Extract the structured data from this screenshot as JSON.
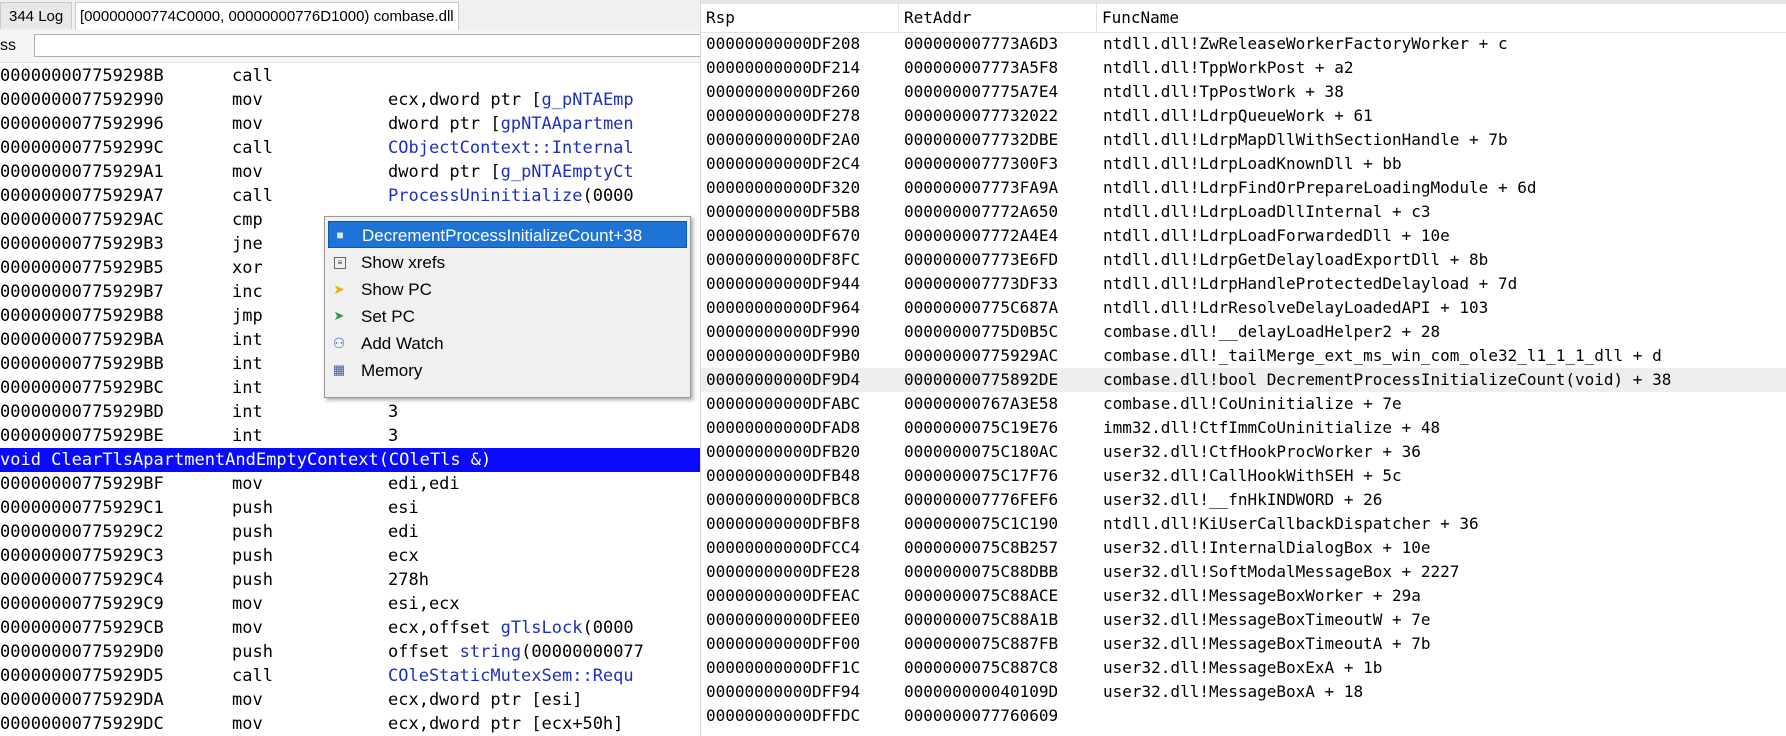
{
  "tabs": {
    "log": "344 Log",
    "module": "[00000000774C0000, 00000000776D1000) combase.dll"
  },
  "address_bar": {
    "label": "ss",
    "value": ""
  },
  "disasm": [
    {
      "addr": "000000007759298B",
      "mn": "call",
      "op": "",
      "sym": false
    },
    {
      "addr": "0000000077592990",
      "mn": "mov",
      "op": "ecx,dword ptr [",
      "sym_text": "g_pNTAEmp",
      "sym": true
    },
    {
      "addr": "0000000077592996",
      "mn": "mov",
      "op": "dword ptr [",
      "sym_text": "gpNTAApartmen",
      "sym": true
    },
    {
      "addr": "000000007759299C",
      "mn": "call",
      "op": "",
      "sym_text": "CObjectContext::Internal",
      "sym": true
    },
    {
      "addr": "00000000775929A1",
      "mn": "mov",
      "op": "dword ptr [",
      "sym_text": "g_pNTAEmptyCt",
      "sym": true
    },
    {
      "addr": "00000000775929A7",
      "mn": "call",
      "op": "",
      "sym_text": "ProcessUninitialize",
      "op2": "(0000",
      "sym": true
    },
    {
      "addr": "00000000775929AC",
      "mn": "cmp",
      "op": "",
      "sym": false
    },
    {
      "addr": "00000000775929B3",
      "mn": "jne",
      "op": "",
      "sym": false
    },
    {
      "addr": "00000000775929B5",
      "mn": "xor",
      "op": "",
      "sym": false
    },
    {
      "addr": "00000000775929B7",
      "mn": "inc",
      "op": "",
      "sym": false
    },
    {
      "addr": "00000000775929B8",
      "mn": "jmp",
      "op": "",
      "sym": false
    },
    {
      "addr": "00000000775929BA",
      "mn": "int",
      "op": "",
      "sym": false
    },
    {
      "addr": "00000000775929BB",
      "mn": "int",
      "op": "",
      "sym": false
    },
    {
      "addr": "00000000775929BC",
      "mn": "int",
      "op": "",
      "sym": false
    },
    {
      "addr": "00000000775929BD",
      "mn": "int",
      "op": "3",
      "sym": false
    },
    {
      "addr": "00000000775929BE",
      "mn": "int",
      "op": "3",
      "sym": false
    }
  ],
  "func_header": "void ClearTlsApartmentAndEmptyContext(COleTls &)",
  "disasm2": [
    {
      "addr": "00000000775929BF",
      "mn": "mov",
      "op": "edi,edi",
      "sym": false
    },
    {
      "addr": "00000000775929C1",
      "mn": "push",
      "op": "esi",
      "sym": false
    },
    {
      "addr": "00000000775929C2",
      "mn": "push",
      "op": "edi",
      "sym": false
    },
    {
      "addr": "00000000775929C3",
      "mn": "push",
      "op": "ecx",
      "sym": false
    },
    {
      "addr": "00000000775929C4",
      "mn": "push",
      "op": "278h",
      "sym": false
    },
    {
      "addr": "00000000775929C9",
      "mn": "mov",
      "op": "esi,ecx",
      "sym": false
    },
    {
      "addr": "00000000775929CB",
      "mn": "mov",
      "op": "ecx,offset ",
      "sym_text": "gTlsLock",
      "op2": "(0000",
      "sym": true
    },
    {
      "addr": "00000000775929D0",
      "mn": "push",
      "op": "offset ",
      "sym_text": "string",
      "op2": "(00000000077",
      "sym": true
    },
    {
      "addr": "00000000775929D5",
      "mn": "call",
      "op": "",
      "sym_text": "COleStaticMutexSem::Requ",
      "sym": true
    },
    {
      "addr": "00000000775929DA",
      "mn": "mov",
      "op": "ecx,dword ptr [esi]",
      "sym": false
    },
    {
      "addr": "00000000775929DC",
      "mn": "mov",
      "op": "ecx,dword ptr [ecx+50h]",
      "sym": false
    }
  ],
  "context_menu": {
    "items": [
      {
        "label": "DecrementProcessInitializeCount+38",
        "icon": "location-icon"
      },
      {
        "label": "Show xrefs",
        "icon": "xrefs-icon"
      },
      {
        "label": "Show PC",
        "icon": "arrow-right-icon"
      },
      {
        "label": "Set PC",
        "icon": "set-pc-icon"
      },
      {
        "label": "Add Watch",
        "icon": "watch-icon"
      },
      {
        "label": "Memory",
        "icon": "memory-icon"
      }
    ]
  },
  "stack": {
    "headers": {
      "rsp": "Rsp",
      "ret": "RetAddr",
      "fn": "FuncName"
    },
    "rows": [
      {
        "rsp": "00000000000DF208",
        "ret": "000000007773A6D3",
        "fn": "ntdll.dll!ZwReleaseWorkerFactoryWorker + c"
      },
      {
        "rsp": "00000000000DF214",
        "ret": "000000007773A5F8",
        "fn": "ntdll.dll!TppWorkPost + a2"
      },
      {
        "rsp": "00000000000DF260",
        "ret": "000000007775A7E4",
        "fn": "ntdll.dll!TpPostWork + 38"
      },
      {
        "rsp": "00000000000DF278",
        "ret": "0000000077732022",
        "fn": "ntdll.dll!LdrpQueueWork + 61"
      },
      {
        "rsp": "00000000000DF2A0",
        "ret": "0000000077732DBE",
        "fn": "ntdll.dll!LdrpMapDllWithSectionHandle + 7b"
      },
      {
        "rsp": "00000000000DF2C4",
        "ret": "00000000777300F3",
        "fn": "ntdll.dll!LdrpLoadKnownDll + bb"
      },
      {
        "rsp": "00000000000DF320",
        "ret": "000000007773FA9A",
        "fn": "ntdll.dll!LdrpFindOrPrepareLoadingModule + 6d"
      },
      {
        "rsp": "00000000000DF5B8",
        "ret": "000000007772A650",
        "fn": "ntdll.dll!LdrpLoadDllInternal + c3"
      },
      {
        "rsp": "00000000000DF670",
        "ret": "000000007772A4E4",
        "fn": "ntdll.dll!LdrpLoadForwardedDll + 10e"
      },
      {
        "rsp": "00000000000DF8FC",
        "ret": "000000007773E6FD",
        "fn": "ntdll.dll!LdrpGetDelayloadExportDll + 8b"
      },
      {
        "rsp": "00000000000DF944",
        "ret": "000000007773DF33",
        "fn": "ntdll.dll!LdrpHandleProtectedDelayload + 7d"
      },
      {
        "rsp": "00000000000DF964",
        "ret": "00000000775C687A",
        "fn": "ntdll.dll!LdrResolveDelayLoadedAPI + 103"
      },
      {
        "rsp": "00000000000DF990",
        "ret": "00000000775D0B5C",
        "fn": "combase.dll!__delayLoadHelper2 + 28"
      },
      {
        "rsp": "00000000000DF9B0",
        "ret": "00000000775929AC",
        "fn": "combase.dll!_tailMerge_ext_ms_win_com_ole32_l1_1_1_dll + d"
      },
      {
        "rsp": "00000000000DF9D4",
        "ret": "00000000775892DE",
        "fn": "combase.dll!bool DecrementProcessInitializeCount(void) + 38",
        "selected": true
      },
      {
        "rsp": "00000000000DFABC",
        "ret": "00000000767A3E58",
        "fn": "combase.dll!CoUninitialize + 7e"
      },
      {
        "rsp": "00000000000DFAD8",
        "ret": "0000000075C19E76",
        "fn": "imm32.dll!CtfImmCoUninitialize + 48"
      },
      {
        "rsp": "00000000000DFB20",
        "ret": "0000000075C180AC",
        "fn": "user32.dll!CtfHookProcWorker + 36"
      },
      {
        "rsp": "00000000000DFB48",
        "ret": "0000000075C17F76",
        "fn": "user32.dll!CallHookWithSEH + 5c"
      },
      {
        "rsp": "00000000000DFBC8",
        "ret": "000000007776FEF6",
        "fn": "user32.dll!__fnHkINDWORD + 26"
      },
      {
        "rsp": "00000000000DFBF8",
        "ret": "0000000075C1C190",
        "fn": "ntdll.dll!KiUserCallbackDispatcher + 36"
      },
      {
        "rsp": "00000000000DFCC4",
        "ret": "0000000075C8B257",
        "fn": "user32.dll!InternalDialogBox + 10e"
      },
      {
        "rsp": "00000000000DFE28",
        "ret": "0000000075C88DBB",
        "fn": "user32.dll!SoftModalMessageBox + 2227"
      },
      {
        "rsp": "00000000000DFEAC",
        "ret": "0000000075C88ACE",
        "fn": "user32.dll!MessageBoxWorker + 29a"
      },
      {
        "rsp": "00000000000DFEE0",
        "ret": "0000000075C88A1B",
        "fn": "user32.dll!MessageBoxTimeoutW + 7e"
      },
      {
        "rsp": "00000000000DFF00",
        "ret": "0000000075C887FB",
        "fn": "user32.dll!MessageBoxTimeoutA + 7b"
      },
      {
        "rsp": "00000000000DFF1C",
        "ret": "0000000075C887C8",
        "fn": "user32.dll!MessageBoxExA + 1b"
      },
      {
        "rsp": "00000000000DFF94",
        "ret": "000000000040109D",
        "fn": "user32.dll!MessageBoxA + 18"
      },
      {
        "rsp": "00000000000DFFDC",
        "ret": "0000000077760609",
        "fn": ""
      }
    ]
  },
  "colors": {
    "func_header_bg": "#0a0aff",
    "symbol": "#1c2fbf",
    "menu_selected": "#1e74d6"
  }
}
